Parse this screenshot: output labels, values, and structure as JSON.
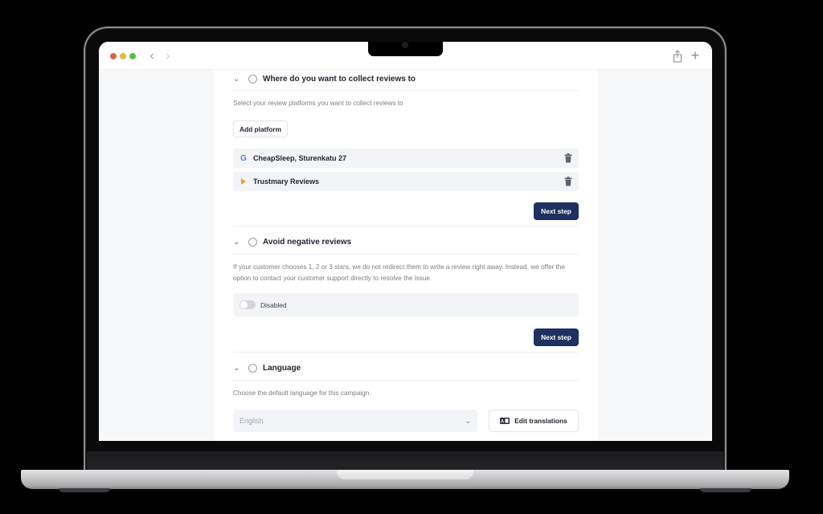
{
  "browser": {
    "back_icon": "‹",
    "forward_icon": "›",
    "new_tab_icon": "+"
  },
  "sections": [
    {
      "title": "Where do you want to collect reviews to",
      "description": "Select your review platforms you want to collect reviews to",
      "add_platform_label": "Add platform",
      "platforms": [
        {
          "name": "CheapSleep, Sturenkatu 27",
          "icon": "google-icon"
        },
        {
          "name": "Trustmary Reviews",
          "icon": "trustmary-icon"
        }
      ],
      "next_label": "Next step"
    },
    {
      "title": "Avoid negative reviews",
      "description": "If your customer chooses 1, 2 or 3 stars, we do not redirect them to write a review right away. Instead, we offer the option to contact your customer support directly to resolve the issue.",
      "toggle_label": "Disabled",
      "toggle_on": false,
      "next_label": "Next step"
    },
    {
      "title": "Language",
      "description": "Choose the default language for this campaign.",
      "language_value": "English",
      "edit_translations_label": "Edit translations"
    }
  ],
  "colors": {
    "primary": "#1e3160",
    "google_blue": "#4285f4",
    "trustmary_orange": "#f4a21c"
  }
}
